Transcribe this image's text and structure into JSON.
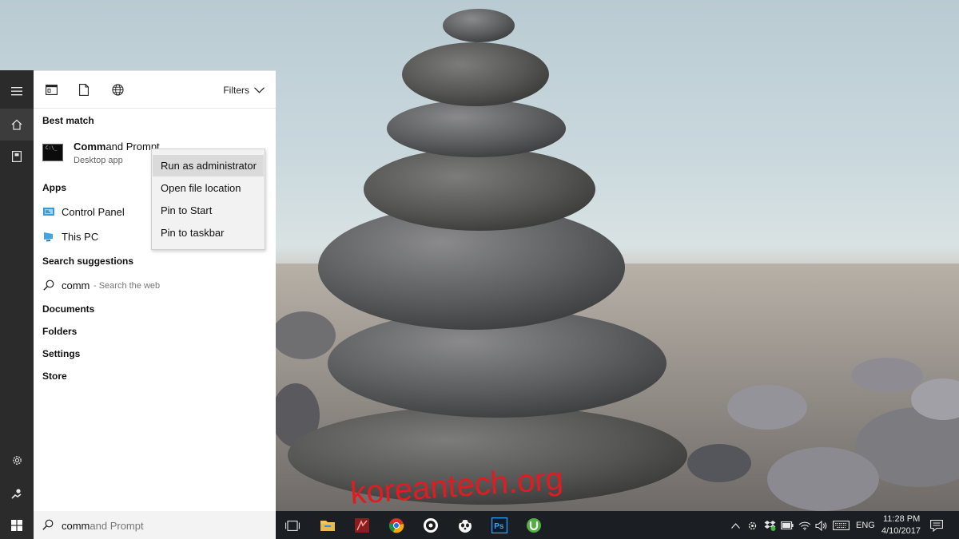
{
  "start_menu": {
    "scope_bar": {
      "filters_label": "Filters"
    },
    "sections": {
      "best_match": "Best match",
      "apps": "Apps",
      "search_suggestions": "Search suggestions",
      "documents": "Documents",
      "folders": "Folders",
      "settings": "Settings",
      "store": "Store"
    },
    "best_match_item": {
      "title_bold": "Comm",
      "title_rest": "and Prompt",
      "subtitle": "Desktop app",
      "icon_text": "C:\\_"
    },
    "apps": [
      {
        "label": "Control Panel",
        "icon": "control-panel-icon"
      },
      {
        "label": "This PC",
        "icon": "this-pc-icon"
      }
    ],
    "web_suggestion": {
      "query": "comm",
      "hint": "- Search the web"
    }
  },
  "context_menu": {
    "items": [
      "Run as administrator",
      "Open file location",
      "Pin to Start",
      "Pin to taskbar"
    ]
  },
  "search_box": {
    "typed": "comm",
    "autocomplete": "and Prompt"
  },
  "taskbar": {
    "apps": [
      "task-view-icon",
      "file-explorer-icon",
      "app-icon",
      "chrome-icon",
      "app-icon-2",
      "panda-icon",
      "photoshop-icon",
      "utorrent-icon"
    ],
    "photoshop_label": "Ps",
    "language": "ENG",
    "time": "11:28 PM",
    "date": "4/10/2017"
  },
  "watermark": "koreantech.org",
  "colors": {
    "rail": "#2b2b2b",
    "taskbar": "#1b1e22",
    "menu_hover": "#dadada",
    "watermark": "#e11b22"
  }
}
